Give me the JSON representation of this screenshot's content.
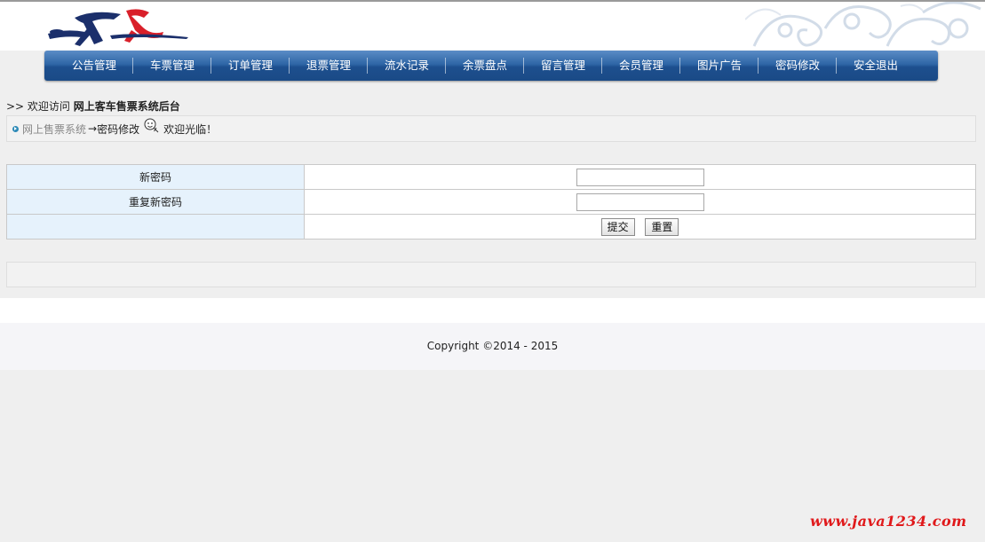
{
  "nav": {
    "items": [
      {
        "label": "公告管理"
      },
      {
        "label": "车票管理"
      },
      {
        "label": "订单管理"
      },
      {
        "label": "退票管理"
      },
      {
        "label": "流水记录"
      },
      {
        "label": "余票盘点"
      },
      {
        "label": "留言管理"
      },
      {
        "label": "会员管理"
      },
      {
        "label": "图片广告"
      },
      {
        "label": "密码修改"
      },
      {
        "label": "安全退出"
      }
    ]
  },
  "welcome": {
    "prefix": ">> 欢迎访问",
    "site_name": "网上客车售票系统后台"
  },
  "breadcrumb": {
    "home": "网上售票系统",
    "separator": "→",
    "current": "密码修改",
    "greeting": "欢迎光临！"
  },
  "form": {
    "new_password_label": "新密码",
    "new_password_value": "",
    "repeat_password_label": "重复新密码",
    "repeat_password_value": "",
    "submit_label": "提交",
    "reset_label": "重置"
  },
  "footer": {
    "copyright": "Copyright ©2014 - 2015"
  },
  "watermark": {
    "text": "www.java1234.com"
  },
  "colors": {
    "nav_top": "#5b8cc6",
    "nav_bottom": "#1a4a86",
    "label_cell_bg": "#e6f2fc",
    "watermark": "#e0191b"
  }
}
